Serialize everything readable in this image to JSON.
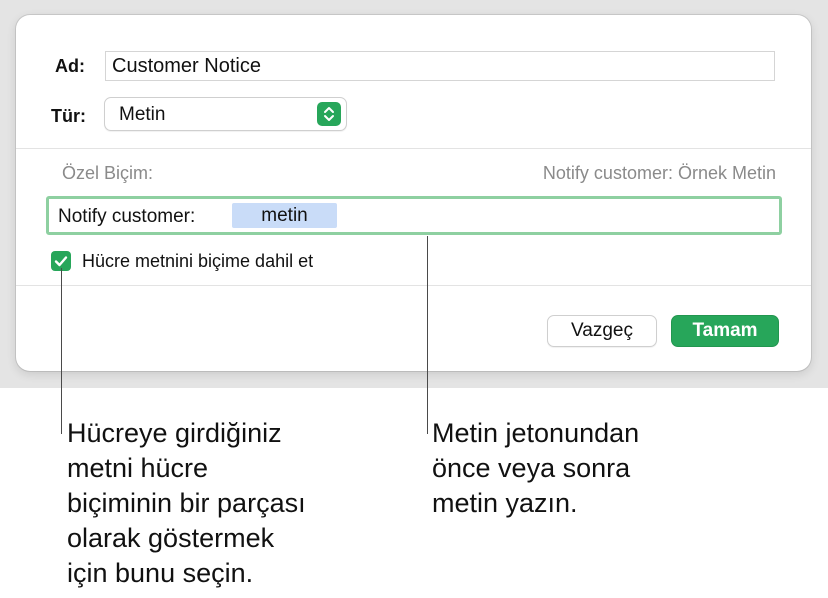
{
  "dialog": {
    "name_label": "Ad:",
    "name_value": "Customer Notice",
    "type_label": "Tür:",
    "type_value": "Metin",
    "custom_format_label": "Özel Biçim:",
    "preview_text": "Notify customer: Örnek Metin",
    "format_prefix": "Notify customer:",
    "format_token": "metin",
    "include_cell_text": {
      "label": "Hücre metnini biçime dahil et",
      "checked": true
    },
    "cancel_label": "Vazgeç",
    "ok_label": "Tamam"
  },
  "colors": {
    "accent": "#27a65a",
    "token_bg": "#c9dcf8",
    "field_focus": "#8ed0a1"
  },
  "callouts": {
    "left": "Hücreye girdiğiniz\nmetni hücre\nbiçiminin bir parçası\nolarak göstermek\niçin bunu seçin.",
    "right": "Metin jetonundan\nönce veya sonra\nmetin yazın."
  }
}
